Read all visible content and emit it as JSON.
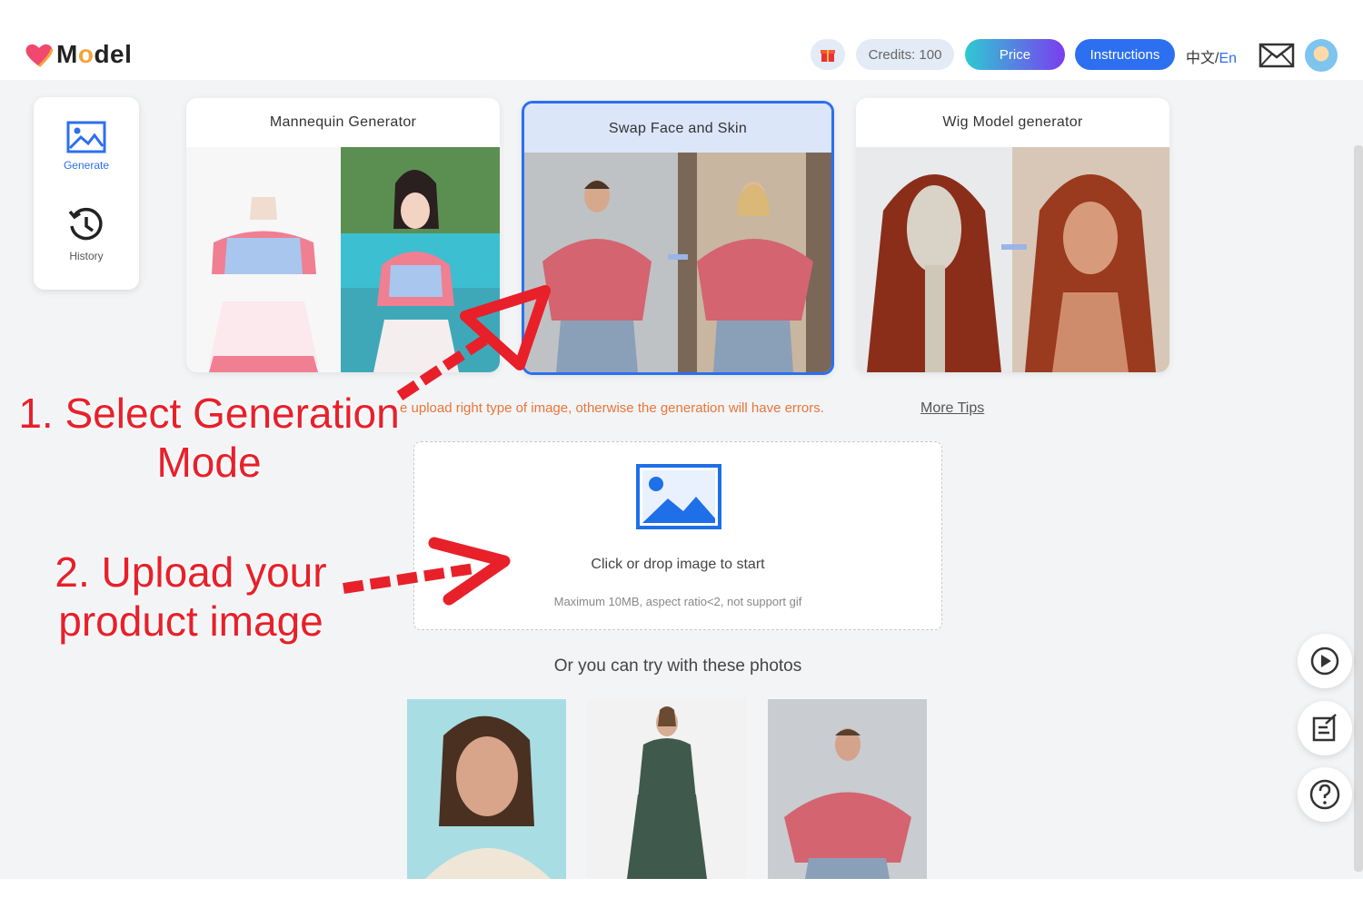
{
  "header": {
    "brand_prefix": "M",
    "brand_o": "o",
    "brand_suffix": "del",
    "credits_label": "Credits: 100",
    "price_label": "Price",
    "instructions_label": "Instructions",
    "lang_zh": "中文/",
    "lang_en": "En"
  },
  "sidebar": {
    "items": [
      {
        "label": "Generate",
        "icon": "image-icon",
        "active": true
      },
      {
        "label": "History",
        "icon": "history-icon",
        "active": false
      }
    ]
  },
  "modes": [
    {
      "title": "Mannequin Generator",
      "selected": false
    },
    {
      "title": "Swap Face and Skin",
      "selected": true
    },
    {
      "title": "Wig Model generator",
      "selected": false
    }
  ],
  "tip": {
    "text": "e upload right type of image, otherwise the generation will have errors.",
    "link": "More Tips"
  },
  "upload": {
    "text": "Click or drop image to start",
    "hint": "Maximum 10MB, aspect ratio<2, not support gif"
  },
  "samples": {
    "label": "Or you can try with these photos"
  },
  "annotations": {
    "step1_line1": "1. Select Generation",
    "step1_line2": "Mode",
    "step2_line1": "2. Upload your",
    "step2_line2": "product image"
  },
  "colors": {
    "accent": "#2c6ff0",
    "annotation": "#e8202a",
    "tip": "#e8763a",
    "brand_heart": "#f0486e"
  }
}
